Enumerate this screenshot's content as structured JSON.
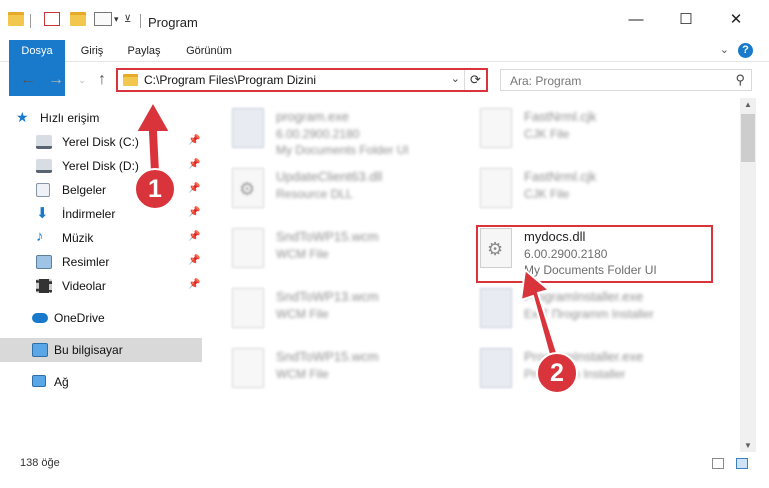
{
  "window": {
    "title": "Program",
    "minimize": "—",
    "maximize": "☐",
    "close": "✕"
  },
  "ribbon": {
    "tabs": [
      "Dosya",
      "Giriş",
      "Paylaş",
      "Görünüm"
    ],
    "help": "?"
  },
  "nav": {
    "back": "←",
    "forward": "→",
    "up": "↑",
    "address": "C:\\Program Files\\Program Dizini",
    "search_placeholder": "Ara: Program"
  },
  "sidebar": {
    "quick_access": "Hızlı erişim",
    "items": [
      {
        "label": "Yerel Disk (C:)",
        "icon": "drive-icon",
        "pinned": true
      },
      {
        "label": "Yerel Disk (D:)",
        "icon": "drive-icon",
        "pinned": true
      },
      {
        "label": "Belgeler",
        "icon": "documents-icon",
        "pinned": true
      },
      {
        "label": "İndirmeler",
        "icon": "download-icon",
        "pinned": true
      },
      {
        "label": "Müzik",
        "icon": "music-icon",
        "pinned": true
      },
      {
        "label": "Resimler",
        "icon": "pictures-icon",
        "pinned": true
      },
      {
        "label": "Videolar",
        "icon": "videos-icon",
        "pinned": true
      }
    ],
    "onedrive": "OneDrive",
    "this_pc": "Bu bilgisayar",
    "network": "Ağ",
    "pin_glyph": "📌"
  },
  "files": {
    "left": [
      {
        "name": "program.exe",
        "line1": "6.00.2900.2180",
        "line2": "My Documents Folder UI"
      },
      {
        "name": "UpdateClient63.dll",
        "line1": "Resource DLL"
      },
      {
        "name": "SndToWP15.wcm",
        "line1": "WCM File"
      },
      {
        "name": "SndToWP13.wcm",
        "line1": "WCM File"
      },
      {
        "name": "SndToWP15.wcm",
        "line1": "WCM File"
      }
    ],
    "right": [
      {
        "name": "FastNrml.cjk",
        "line1": "CJK File"
      },
      {
        "name": "FastNrml.cjk",
        "line1": "CJK File"
      },
      {
        "name": "mydocs.dll",
        "line1": "6.00.2900.2180",
        "line2": "My Documents Folder UI"
      },
      {
        "name": "ProgramInstaller.exe",
        "line1": "ExIT Пrogramm Installer"
      },
      {
        "name": "ProgramInstaller.exe",
        "line1": "Programm Installer"
      }
    ]
  },
  "status": {
    "count": "138 öğe"
  },
  "annotations": {
    "badge1": "1",
    "badge2": "2"
  },
  "colors": {
    "accent": "#1979ca",
    "highlight": "#d9343b"
  }
}
